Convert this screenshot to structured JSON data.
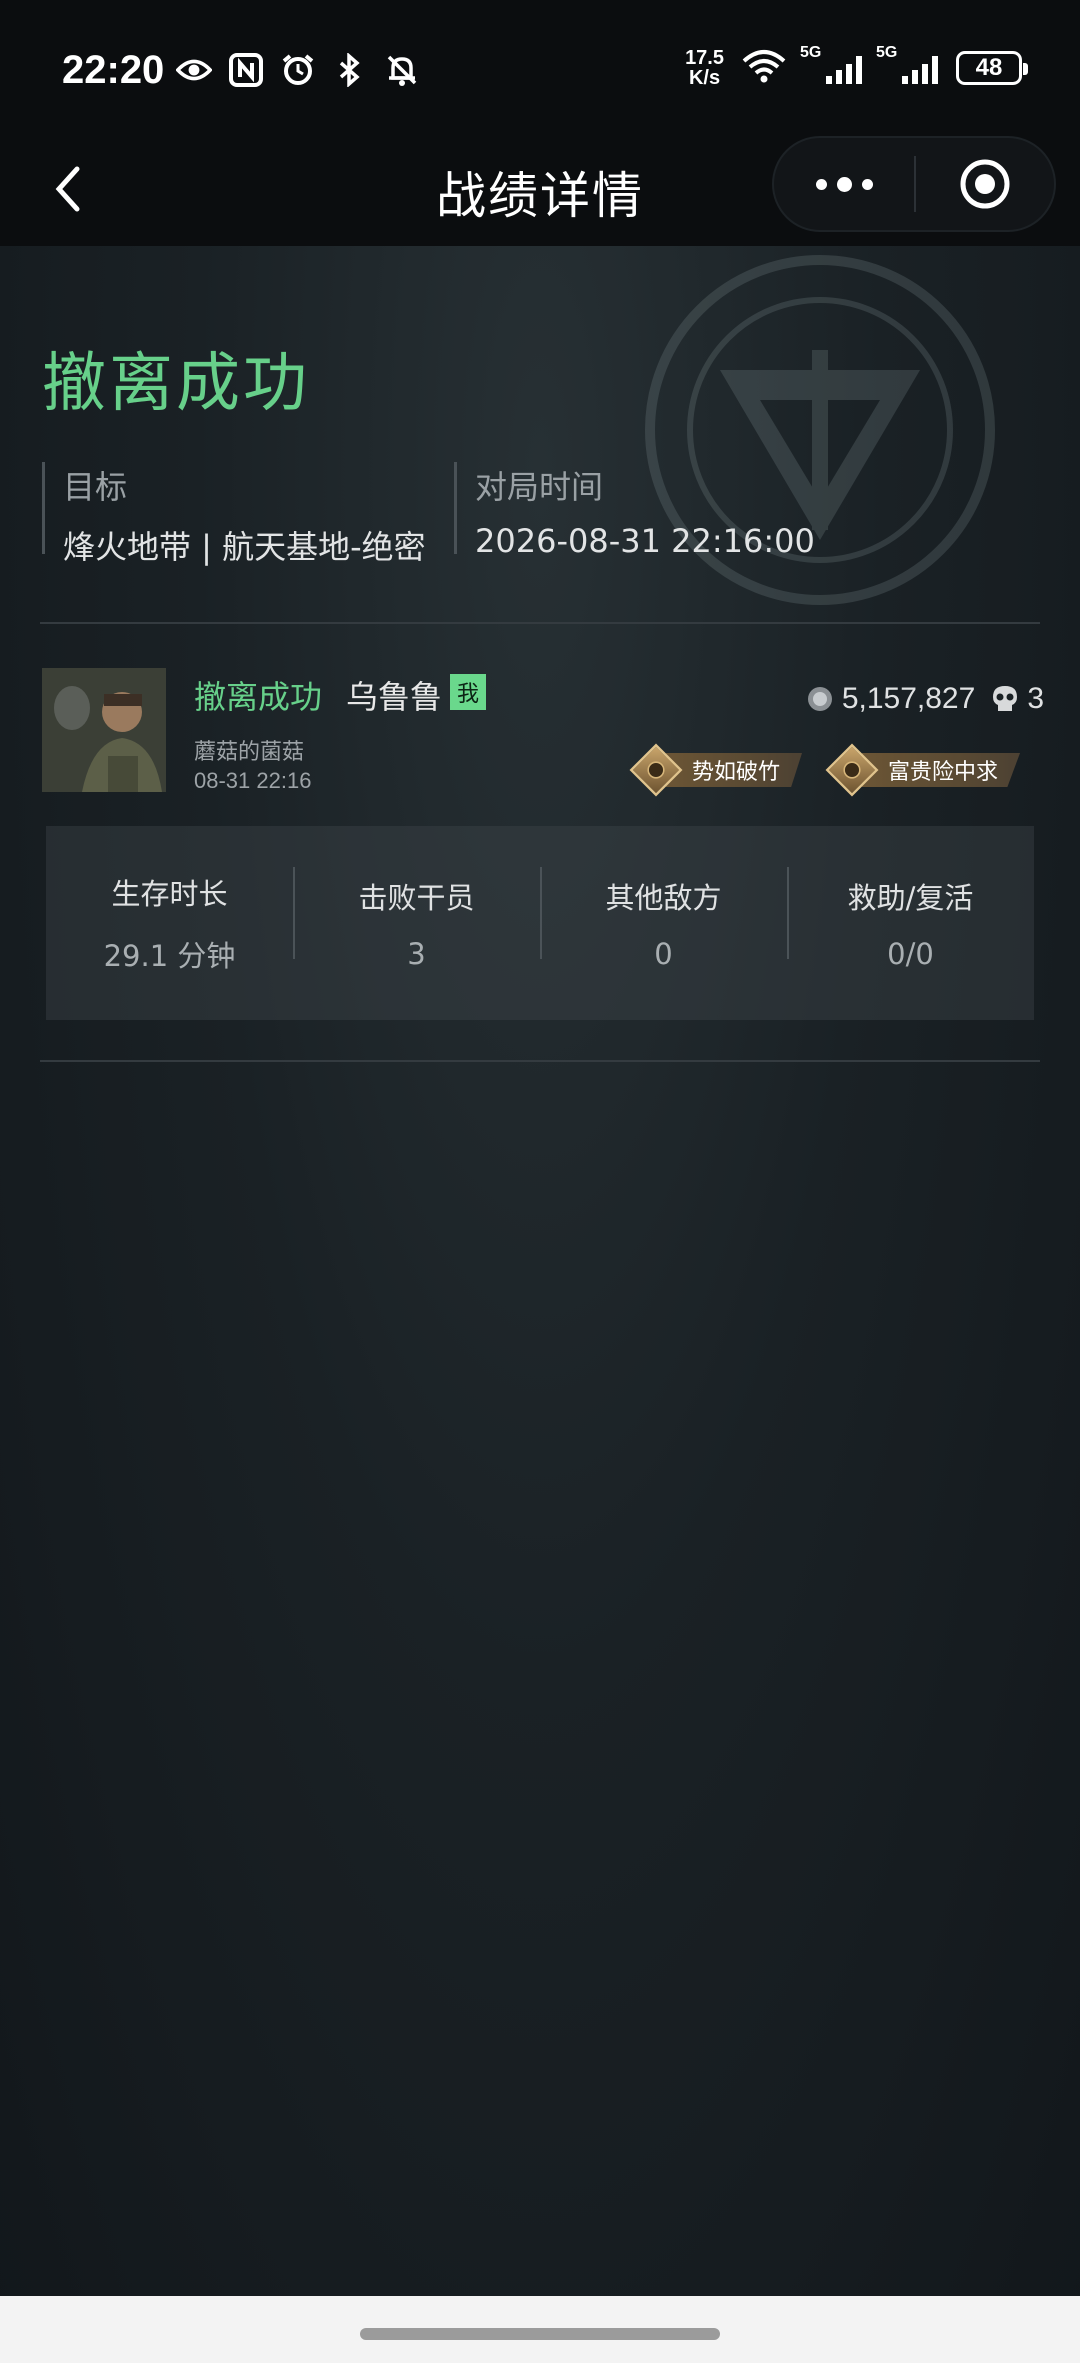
{
  "status_bar": {
    "time": "22:20",
    "net_speed_value": "17.5",
    "net_speed_unit": "K/s",
    "signal1_label": "5G",
    "signal2_label": "5G",
    "battery": "48",
    "icons_left": [
      "eye-icon",
      "nfc-icon",
      "alarm-icon",
      "bluetooth-icon",
      "bell-off-icon"
    ]
  },
  "nav": {
    "title": "战绩详情"
  },
  "result": {
    "title": "撤离成功",
    "target_label": "目标",
    "target_value": "烽火地带 | 航天基地-绝密",
    "time_label": "对局时间",
    "time_value": "2026-08-31 22:16:00"
  },
  "player": {
    "status": "撤离成功",
    "name": "乌鲁鲁",
    "me_tag": "我",
    "subtitle": "蘑菇的菌菇",
    "timestamp": "08-31 22:16",
    "value": "5,157,827",
    "kills": "3",
    "badges": [
      "势如破竹",
      "富贵险中求"
    ]
  },
  "stats": [
    {
      "label": "生存时长",
      "value": "29.1 分钟"
    },
    {
      "label": "击败干员",
      "value": "3"
    },
    {
      "label": "其他敌方",
      "value": "0"
    },
    {
      "label": "救助/复活",
      "value": "0/0"
    }
  ],
  "colors": {
    "accent_green": "#67d08a",
    "background": "#1a2125"
  }
}
